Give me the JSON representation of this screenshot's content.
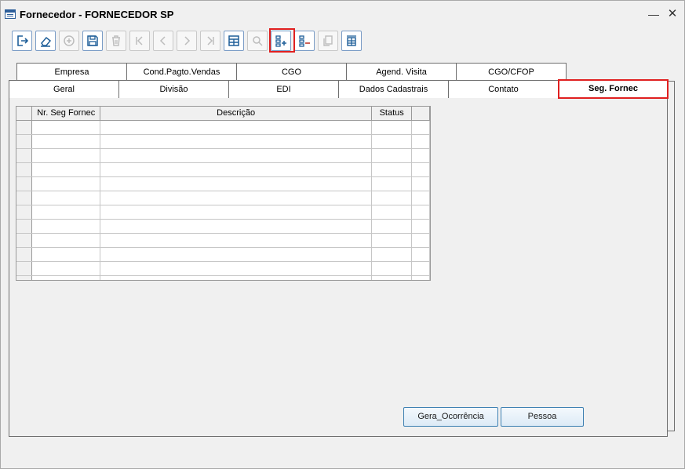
{
  "window": {
    "title": "Fornecedor - FORNECEDOR SP",
    "minimize_glyph": "—",
    "close_glyph": "✕"
  },
  "toolbar": {
    "buttons": [
      {
        "name": "exit-button",
        "icon": "exit-icon",
        "enabled": true
      },
      {
        "name": "clear-button",
        "icon": "eraser-icon",
        "enabled": true
      },
      {
        "name": "add-button",
        "icon": "plus-circle-icon",
        "enabled": false
      },
      {
        "name": "save-button",
        "icon": "floppy-icon",
        "enabled": true
      },
      {
        "name": "delete-button",
        "icon": "trash-icon",
        "enabled": false
      },
      {
        "name": "first-button",
        "icon": "first-record-icon",
        "enabled": false
      },
      {
        "name": "previous-button",
        "icon": "chevron-left-icon",
        "enabled": false
      },
      {
        "name": "next-button",
        "icon": "chevron-right-icon",
        "enabled": false
      },
      {
        "name": "last-button",
        "icon": "last-record-icon",
        "enabled": false
      },
      {
        "name": "grid-view-button",
        "icon": "table-icon",
        "enabled": true
      },
      {
        "name": "search-button",
        "icon": "search-icon",
        "enabled": false
      },
      {
        "name": "insert-row-button",
        "icon": "list-add-icon",
        "enabled": true
      },
      {
        "name": "remove-row-button",
        "icon": "list-remove-icon",
        "enabled": true
      },
      {
        "name": "copy-button",
        "icon": "copy-icon",
        "enabled": false
      },
      {
        "name": "columns-button",
        "icon": "columns-icon",
        "enabled": true
      }
    ]
  },
  "tabs": {
    "row1": [
      "Empresa",
      "Cond.Pagto.Vendas",
      "CGO",
      "Agend. Visita",
      "CGO/CFOP"
    ],
    "row2": [
      "Geral",
      "Divisão",
      "EDI",
      "Dados Cadastrais",
      "Contato",
      "Seg. Fornec"
    ],
    "active": "Seg. Fornec"
  },
  "grid": {
    "columns": [
      "Nr. Seg Fornec",
      "Descrição",
      "Status"
    ],
    "row_count": 12
  },
  "buttons": {
    "gera_ocorrencia": "Gera_Ocorrência",
    "pessoa": "Pessoa"
  },
  "colors": {
    "accent_border": "#3c7fb1",
    "highlight": "#e02020",
    "icon_blue": "#1f5f99"
  }
}
